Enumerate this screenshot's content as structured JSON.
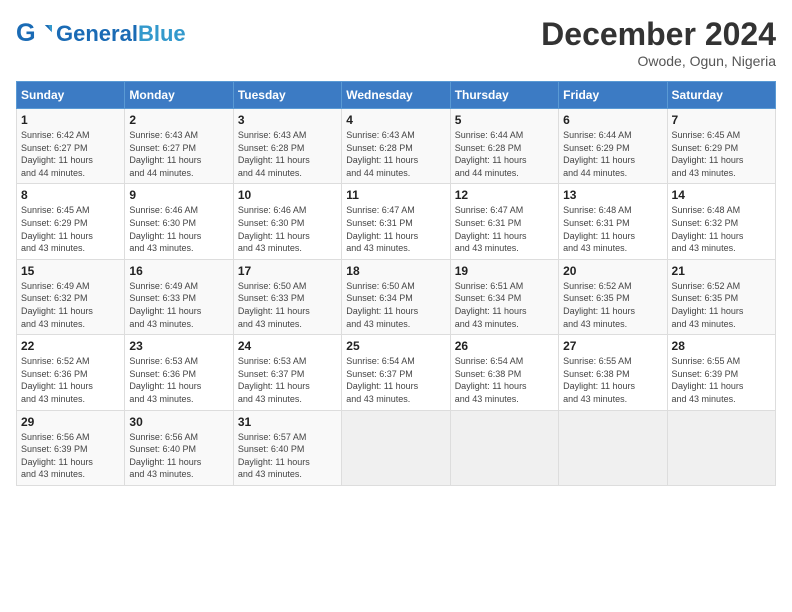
{
  "header": {
    "logo_line1": "General",
    "logo_line2": "Blue",
    "month": "December 2024",
    "location": "Owode, Ogun, Nigeria"
  },
  "weekdays": [
    "Sunday",
    "Monday",
    "Tuesday",
    "Wednesday",
    "Thursday",
    "Friday",
    "Saturday"
  ],
  "weeks": [
    [
      {
        "day": "1",
        "sunrise": "6:42 AM",
        "sunset": "6:27 PM",
        "daylight": "11 hours and 44 minutes."
      },
      {
        "day": "2",
        "sunrise": "6:43 AM",
        "sunset": "6:27 PM",
        "daylight": "11 hours and 44 minutes."
      },
      {
        "day": "3",
        "sunrise": "6:43 AM",
        "sunset": "6:28 PM",
        "daylight": "11 hours and 44 minutes."
      },
      {
        "day": "4",
        "sunrise": "6:43 AM",
        "sunset": "6:28 PM",
        "daylight": "11 hours and 44 minutes."
      },
      {
        "day": "5",
        "sunrise": "6:44 AM",
        "sunset": "6:28 PM",
        "daylight": "11 hours and 44 minutes."
      },
      {
        "day": "6",
        "sunrise": "6:44 AM",
        "sunset": "6:29 PM",
        "daylight": "11 hours and 44 minutes."
      },
      {
        "day": "7",
        "sunrise": "6:45 AM",
        "sunset": "6:29 PM",
        "daylight": "11 hours and 43 minutes."
      }
    ],
    [
      {
        "day": "8",
        "sunrise": "6:45 AM",
        "sunset": "6:29 PM",
        "daylight": "11 hours and 43 minutes."
      },
      {
        "day": "9",
        "sunrise": "6:46 AM",
        "sunset": "6:30 PM",
        "daylight": "11 hours and 43 minutes."
      },
      {
        "day": "10",
        "sunrise": "6:46 AM",
        "sunset": "6:30 PM",
        "daylight": "11 hours and 43 minutes."
      },
      {
        "day": "11",
        "sunrise": "6:47 AM",
        "sunset": "6:31 PM",
        "daylight": "11 hours and 43 minutes."
      },
      {
        "day": "12",
        "sunrise": "6:47 AM",
        "sunset": "6:31 PM",
        "daylight": "11 hours and 43 minutes."
      },
      {
        "day": "13",
        "sunrise": "6:48 AM",
        "sunset": "6:31 PM",
        "daylight": "11 hours and 43 minutes."
      },
      {
        "day": "14",
        "sunrise": "6:48 AM",
        "sunset": "6:32 PM",
        "daylight": "11 hours and 43 minutes."
      }
    ],
    [
      {
        "day": "15",
        "sunrise": "6:49 AM",
        "sunset": "6:32 PM",
        "daylight": "11 hours and 43 minutes."
      },
      {
        "day": "16",
        "sunrise": "6:49 AM",
        "sunset": "6:33 PM",
        "daylight": "11 hours and 43 minutes."
      },
      {
        "day": "17",
        "sunrise": "6:50 AM",
        "sunset": "6:33 PM",
        "daylight": "11 hours and 43 minutes."
      },
      {
        "day": "18",
        "sunrise": "6:50 AM",
        "sunset": "6:34 PM",
        "daylight": "11 hours and 43 minutes."
      },
      {
        "day": "19",
        "sunrise": "6:51 AM",
        "sunset": "6:34 PM",
        "daylight": "11 hours and 43 minutes."
      },
      {
        "day": "20",
        "sunrise": "6:52 AM",
        "sunset": "6:35 PM",
        "daylight": "11 hours and 43 minutes."
      },
      {
        "day": "21",
        "sunrise": "6:52 AM",
        "sunset": "6:35 PM",
        "daylight": "11 hours and 43 minutes."
      }
    ],
    [
      {
        "day": "22",
        "sunrise": "6:52 AM",
        "sunset": "6:36 PM",
        "daylight": "11 hours and 43 minutes."
      },
      {
        "day": "23",
        "sunrise": "6:53 AM",
        "sunset": "6:36 PM",
        "daylight": "11 hours and 43 minutes."
      },
      {
        "day": "24",
        "sunrise": "6:53 AM",
        "sunset": "6:37 PM",
        "daylight": "11 hours and 43 minutes."
      },
      {
        "day": "25",
        "sunrise": "6:54 AM",
        "sunset": "6:37 PM",
        "daylight": "11 hours and 43 minutes."
      },
      {
        "day": "26",
        "sunrise": "6:54 AM",
        "sunset": "6:38 PM",
        "daylight": "11 hours and 43 minutes."
      },
      {
        "day": "27",
        "sunrise": "6:55 AM",
        "sunset": "6:38 PM",
        "daylight": "11 hours and 43 minutes."
      },
      {
        "day": "28",
        "sunrise": "6:55 AM",
        "sunset": "6:39 PM",
        "daylight": "11 hours and 43 minutes."
      }
    ],
    [
      {
        "day": "29",
        "sunrise": "6:56 AM",
        "sunset": "6:39 PM",
        "daylight": "11 hours and 43 minutes."
      },
      {
        "day": "30",
        "sunrise": "6:56 AM",
        "sunset": "6:40 PM",
        "daylight": "11 hours and 43 minutes."
      },
      {
        "day": "31",
        "sunrise": "6:57 AM",
        "sunset": "6:40 PM",
        "daylight": "11 hours and 43 minutes."
      },
      null,
      null,
      null,
      null
    ]
  ]
}
